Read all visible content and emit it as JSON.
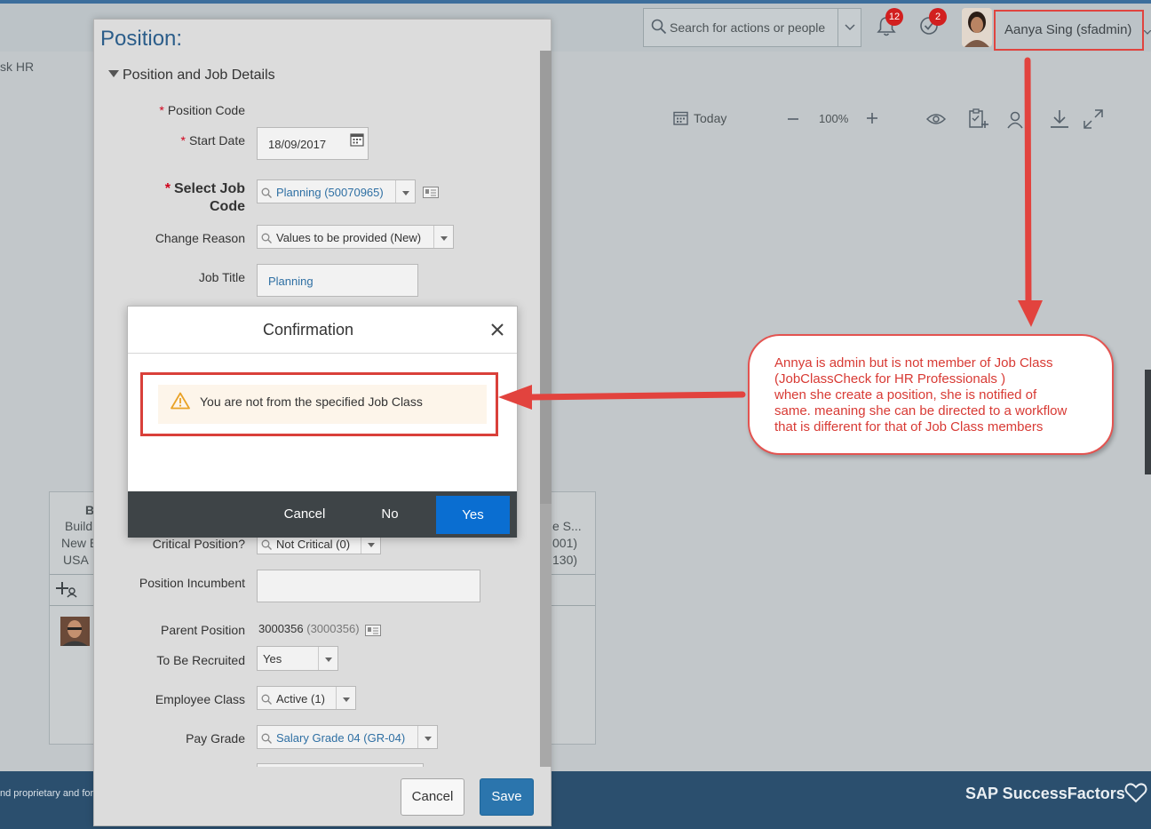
{
  "shell": {
    "search_placeholder": "Search for actions or people",
    "notifications_count": "12",
    "todo_count": "2",
    "user_name": "Aanya Sing (sfadmin)",
    "left_label": "sk HR"
  },
  "toolbar": {
    "today_label": "Today",
    "zoom_level": "100%"
  },
  "org_card": {
    "left_lines": [
      "B",
      "Buildi",
      "New E",
      "USA"
    ],
    "right_lines": [
      "e S...",
      "001)",
      "130)"
    ]
  },
  "position_dialog": {
    "title": "Position:",
    "section_title": "Position and Job Details",
    "fields": {
      "position_code_label": "Position Code",
      "start_date_label": "Start Date",
      "start_date_value": "18/09/2017",
      "job_code_label_line1": "Select Job",
      "job_code_label_line2": "Code",
      "job_code_value": "Planning (50070965)",
      "change_reason_label": "Change Reason",
      "change_reason_value": "Values to be provided (New)",
      "job_title_label": "Job Title",
      "job_title_value": "Planning",
      "critical_position_label": "Critical Position?",
      "critical_position_value": "Not Critical (0)",
      "incumbent_label": "Position Incumbent",
      "incumbent_value": "",
      "parent_position_label": "Parent Position",
      "parent_position_value": "3000356",
      "parent_position_id": "(3000356)",
      "recruited_label": "To Be Recruited",
      "recruited_value": "Yes",
      "employee_class_label": "Employee Class",
      "employee_class_value": "Active (1)",
      "pay_grade_label": "Pay Grade",
      "pay_grade_value": "Salary Grade 04 (GR-04)"
    },
    "required_mark": "*",
    "cancel_label": "Cancel",
    "save_label": "Save"
  },
  "confirmation": {
    "title": "Confirmation",
    "message": "You are not from the specified Job Class",
    "cancel_label": "Cancel",
    "no_label": "No",
    "yes_label": "Yes"
  },
  "annotation": {
    "lines": [
      "Annya is admin but is not member of Job Class",
      "(JobClassCheck for HR Professionals )",
      "when she create a position, she is notified of",
      "same. meaning she can be directed to  a workflow",
      "that is different for that of  Job Class members"
    ],
    "color": "#d83a34"
  },
  "footer": {
    "legal_text": "nd proprietary and for",
    "brand": "SAP SuccessFactors"
  },
  "colors": {
    "accent_blue": "#0a6ed1",
    "highlight_red": "#e0443f",
    "footer_bg": "#2b4f6e"
  }
}
